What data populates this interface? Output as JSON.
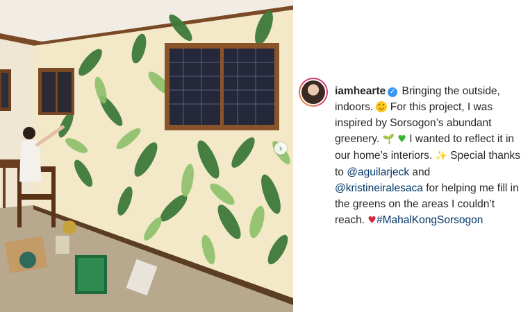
{
  "post": {
    "username": "iamhearte",
    "verified_icon": "verified-badge-icon",
    "caption": {
      "p1": "Bringing the outside, indoors.",
      "p2": "For this project, I was inspired by Sorsogon’s abundant greenery.",
      "p3": "I wanted to reflect it in our home’s interiors.",
      "p4": "Special thanks to",
      "mention1": "@aguilarjeck",
      "and": "and",
      "mention2": "@kristineiralesaca",
      "p5": "for helping me fill in the greens on the areas I couldn’t reach.",
      "hashtag": "#MahalKongSorsogon"
    },
    "emojis": {
      "smile": "smile-emoji",
      "sprout": "🌱",
      "green_heart": "♥",
      "sparkles": "✨",
      "red_heart": "♥"
    }
  },
  "colors": {
    "link": "#003569",
    "text": "#262626",
    "verified": "#3897f0",
    "leaf_dark": "#3d7a3a",
    "leaf_light": "#8cc06a"
  },
  "photo": {
    "description_icon": "photo-mural-image",
    "next_icon": "chevron-right-icon"
  }
}
